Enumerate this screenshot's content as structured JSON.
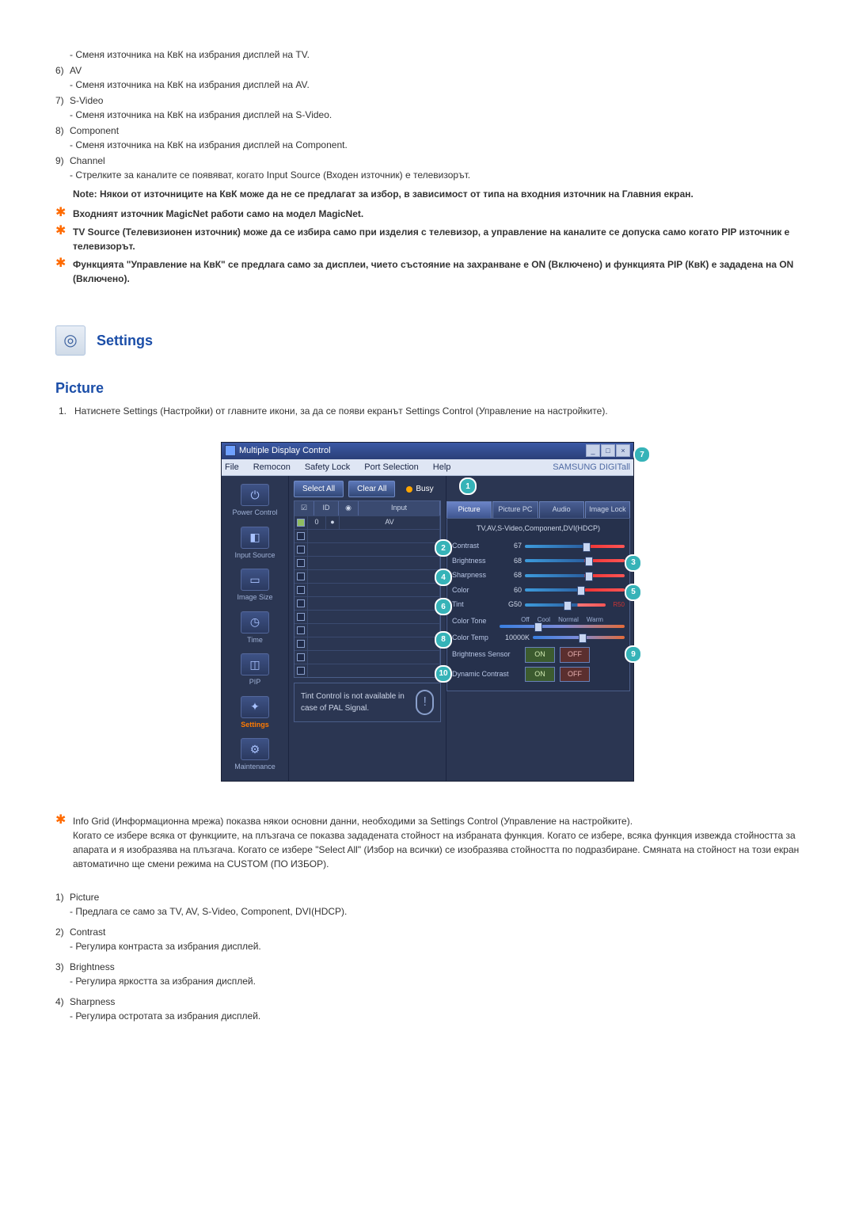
{
  "top_items": [
    {
      "text": "- Сменя източника на КвК на избрания дисплей на TV."
    },
    {
      "num": "6)",
      "label": "AV",
      "text": "- Сменя източника на КвК на избрания дисплей на AV."
    },
    {
      "num": "7)",
      "label": "S-Video",
      "text": "- Сменя източника на КвК на избрания дисплей на S-Video."
    },
    {
      "num": "8)",
      "label": "Component",
      "text": "- Сменя източника на КвК на избрания дисплей на Component."
    },
    {
      "num": "9)",
      "label": "Channel",
      "text": "- Стрелките за каналите се появяват, когато Input Source (Входен източник) е телевизорът."
    }
  ],
  "note": "Note: Някои от източниците на КвК може да не се предлагат за избор, в зависимост от типа на входния източник на Главния екран.",
  "stars": [
    "Входният източник MagicNet работи само на модел MagicNet.",
    "TV Source (Телевизионен източник) може да се избира само при изделия с телевизор, а управление на каналите се допуска само когато PIP източник е телевизорът.",
    "Функцията \"Управление на КвК\" се предлага само за дисплеи, чието състояние на захранване е ON (Включено) и функцията PIP (КвК) е зададена на ON (Включено)."
  ],
  "settings_head": "Settings",
  "picture_head": "Picture",
  "picture_intro_num": "1.",
  "picture_intro": "Натиснете Settings (Настройки) от главните икони, за да се появи екранът Settings Control (Управление на настройките).",
  "app": {
    "title": "Multiple Display Control",
    "menu": [
      "File",
      "Remocon",
      "Safety Lock",
      "Port Selection",
      "Help"
    ],
    "brand": "SAMSUNG DIGITall",
    "sidebar": [
      {
        "icon": "⏻",
        "label": "Power Control"
      },
      {
        "icon": "◧",
        "label": "Input Source"
      },
      {
        "icon": "▭",
        "label": "Image Size"
      },
      {
        "icon": "◷",
        "label": "Time"
      },
      {
        "icon": "◫",
        "label": "PIP"
      },
      {
        "icon": "✦",
        "label": "Settings",
        "active": true
      },
      {
        "icon": "⚙",
        "label": "Maintenance"
      }
    ],
    "select_all": "Select All",
    "clear_all": "Clear All",
    "busy": "Busy",
    "grid_headers": {
      "id": "ID",
      "input": "Input"
    },
    "grid_first": {
      "id": "0",
      "input": "AV"
    },
    "marker_1": "1",
    "tabs": [
      "Picture",
      "Picture PC",
      "Audio",
      "Image Lock"
    ],
    "tab_sub": "TV,AV,S-Video,Component,DVI(HDCP)",
    "rows": {
      "contrast": {
        "label": "Contrast",
        "val": "67",
        "marker": "2",
        "end_marker": "3"
      },
      "brightness": {
        "label": "Brightness",
        "val": "68"
      },
      "sharpness": {
        "label": "Sharpness",
        "val": "68",
        "marker": "4",
        "end_marker": "5"
      },
      "color": {
        "label": "Color",
        "val": "60"
      },
      "tint": {
        "label": "Tint",
        "val": "G50",
        "marker": "6",
        "end": "R50"
      },
      "colortone": {
        "label": "Color Tone",
        "opts": [
          "Off",
          "Cool",
          "Normal",
          "Warm"
        ],
        "end_marker": "7"
      },
      "colortemp": {
        "label": "Color Temp",
        "val": "10000K",
        "marker": "8"
      },
      "bsensor": {
        "label": "Brightness Sensor",
        "on": "ON",
        "off": "OFF",
        "end_marker": "9"
      },
      "dcontrast": {
        "label": "Dynamic Contrast",
        "on": "ON",
        "off": "OFF",
        "marker": "10"
      }
    },
    "footnote": "Tint Control is not available in case of PAL Signal."
  },
  "after_star": "Info Grid (Информационна мрежа) показва някои основни данни, необходими за Settings Control (Управление на настройките).\nКогато се избере всяка от функциите, на плъзгача се показва зададената стойност на избраната функция. Когато се избере, всяка функция извежда стойността за апарата и я изобразява на плъзгача. Когато се избере \"Select All\" (Избор на всички) се изобразява стойността по подразбиране. Смяната на стойност на този екран автоматично ще смени режима на CUSTOM (ПО ИЗБОР).",
  "bottom_items": [
    {
      "num": "1)",
      "label": "Picture",
      "text": "- Предлага се само за TV, AV, S-Video, Component, DVI(HDCP)."
    },
    {
      "num": "2)",
      "label": "Contrast",
      "text": "- Регулира контраста за избрания дисплей."
    },
    {
      "num": "3)",
      "label": "Brightness",
      "text": "- Регулира яркостта за избрания дисплей."
    },
    {
      "num": "4)",
      "label": "Sharpness",
      "text": "- Регулира остротата за избрания дисплей."
    }
  ]
}
